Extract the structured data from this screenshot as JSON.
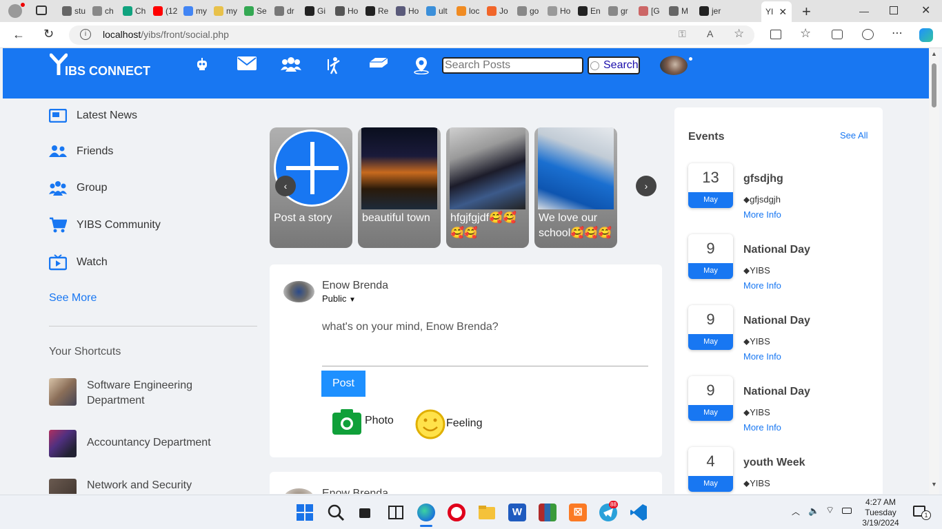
{
  "browser": {
    "tabs": [
      {
        "label": "stu",
        "color": "#666"
      },
      {
        "label": "ch",
        "color": "#888"
      },
      {
        "label": "Ch",
        "color": "#10a37f"
      },
      {
        "label": "(12",
        "color": "#ff0000"
      },
      {
        "label": "my",
        "color": "#4285f4"
      },
      {
        "label": "my",
        "color": "#e8c14a"
      },
      {
        "label": "Se",
        "color": "#34a853"
      },
      {
        "label": "dr",
        "color": "#777"
      },
      {
        "label": "Gi",
        "color": "#222"
      },
      {
        "label": "Ho",
        "color": "#555"
      },
      {
        "label": "Re",
        "color": "#222"
      },
      {
        "label": "Ho",
        "color": "#5a5a7a"
      },
      {
        "label": "ult",
        "color": "#3b8fd9"
      },
      {
        "label": "loc",
        "color": "#f08b22"
      },
      {
        "label": "Jo",
        "color": "#f16529"
      },
      {
        "label": "go",
        "color": "#888"
      },
      {
        "label": "Ho",
        "color": "#999"
      },
      {
        "label": "En",
        "color": "#222"
      },
      {
        "label": "gr",
        "color": "#888"
      },
      {
        "label": "[G",
        "color": "#c66"
      },
      {
        "label": "M",
        "color": "#666"
      },
      {
        "label": "jer",
        "color": "#222"
      }
    ],
    "active_tab": "YI",
    "url_host": "localhost",
    "url_path": "/yibs/front/social.php"
  },
  "header": {
    "logo_text": "IBS CONNECT",
    "search_placeholder": "Search Posts",
    "search_button": "Search",
    "nav_icons": [
      "robot-icon",
      "mail-icon",
      "group-icon",
      "tennis-icon",
      "tray-icon",
      "location-icon"
    ]
  },
  "sidebar": {
    "items": [
      {
        "label": "Latest News",
        "icon": "news-icon"
      },
      {
        "label": "Friends",
        "icon": "friends-icon"
      },
      {
        "label": "Group",
        "icon": "group-icon"
      },
      {
        "label": "YIBS Community",
        "icon": "cart-icon"
      },
      {
        "label": "Watch",
        "icon": "tv-icon"
      }
    ],
    "see_more": "See More",
    "shortcuts_title": "Your Shortcuts",
    "shortcuts": [
      {
        "label": "Software Engineering Department"
      },
      {
        "label": "Accountancy Department"
      },
      {
        "label": "Network and Security"
      }
    ]
  },
  "stories": [
    {
      "caption": "Post a story"
    },
    {
      "caption": "beautiful town"
    },
    {
      "caption": "hfgjfgjdf🥰🥰🥰🥰"
    },
    {
      "caption": "We love our school🥰🥰🥰"
    }
  ],
  "composer": {
    "user_name": "Enow Brenda",
    "privacy": "Public",
    "placeholder": "what's on your mind, Enow Brenda?",
    "post_button": "Post",
    "photo_label": "Photo",
    "feeling_label": "Feeling"
  },
  "next_post": {
    "user_name": "Enow Brenda"
  },
  "events": {
    "title": "Events",
    "see_all": "See All",
    "items": [
      {
        "day": "13",
        "month": "May",
        "title": "gfsdjhg",
        "location": "gfjsdgjh",
        "more": "More Info"
      },
      {
        "day": "9",
        "month": "May",
        "title": "National Day",
        "location": "YIBS",
        "more": "More Info"
      },
      {
        "day": "9",
        "month": "May",
        "title": "National Day",
        "location": "YIBS",
        "more": "More Info"
      },
      {
        "day": "9",
        "month": "May",
        "title": "National Day",
        "location": "YIBS",
        "more": "More Info"
      },
      {
        "day": "4",
        "month": "May",
        "title": "youth Week",
        "location": "YIBS",
        "more": ""
      }
    ]
  },
  "taskbar": {
    "time": "4:27 AM",
    "day": "Tuesday",
    "date": "3/19/2024",
    "telegram_badge": "88",
    "notification_count": "1"
  }
}
